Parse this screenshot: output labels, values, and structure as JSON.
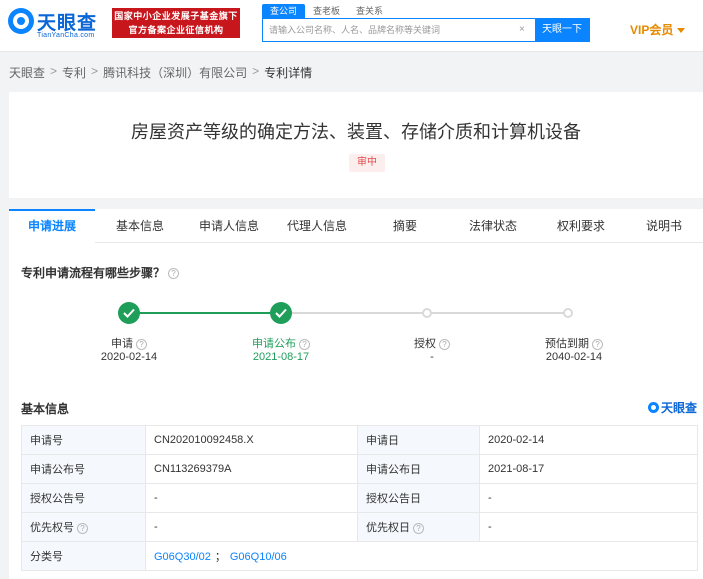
{
  "header": {
    "logo_text": "天眼查",
    "logo_sub": "TianYanCha.com",
    "badge_line1": "国家中小企业发展子基金旗下",
    "badge_line2": "官方备案企业征信机构",
    "search_tabs": [
      "查公司",
      "查老板",
      "查关系"
    ],
    "search_placeholder": "请输入公司名称、人名、品牌名称等关键词",
    "clear_icon": "×",
    "search_button": "天眼一下",
    "vip_label": "VIP会员",
    "accent_color": "#0a84ff"
  },
  "breadcrumb": [
    "天眼查",
    "专利",
    "腾讯科技（深圳）有限公司",
    "专利详情"
  ],
  "breadcrumb_sep": ">",
  "patent": {
    "title": "房屋资产等级的确定方法、装置、存储介质和计算机设备",
    "status": "审中"
  },
  "tabs": [
    "申请进展",
    "基本信息",
    "申请人信息",
    "代理人信息",
    "摘要",
    "法律状态",
    "权利要求",
    "说明书"
  ],
  "progress": {
    "question": "专利申请流程有哪些步骤？",
    "help_icon": "?",
    "steps": [
      {
        "label": "申请",
        "date": "2020-02-14",
        "done": true
      },
      {
        "label": "申请公布",
        "date": "2021-08-17",
        "done": true
      },
      {
        "label": "授权",
        "date": "-",
        "done": false
      },
      {
        "label": "预估到期",
        "date": "2040-02-14",
        "done": false
      }
    ],
    "done_color": "#1f9e5a"
  },
  "basic_info": {
    "title": "基本信息",
    "brand": "天眼查",
    "rows": [
      {
        "l1": "申请号",
        "v1": "CN202010092458.X",
        "l2": "申请日",
        "v2": "2020-02-14"
      },
      {
        "l1": "申请公布号",
        "v1": "CN113269379A",
        "l2": "申请公布日",
        "v2": "2021-08-17"
      },
      {
        "l1": "授权公告号",
        "v1": "-",
        "l2": "授权公告日",
        "v2": "-"
      },
      {
        "l1": "优先权号",
        "v1": "-",
        "l2": "优先权日",
        "v2": "-"
      }
    ],
    "class_label": "分类号",
    "class_codes": [
      "G06Q30/02",
      "G06Q10/06"
    ],
    "class_sep": "；"
  }
}
